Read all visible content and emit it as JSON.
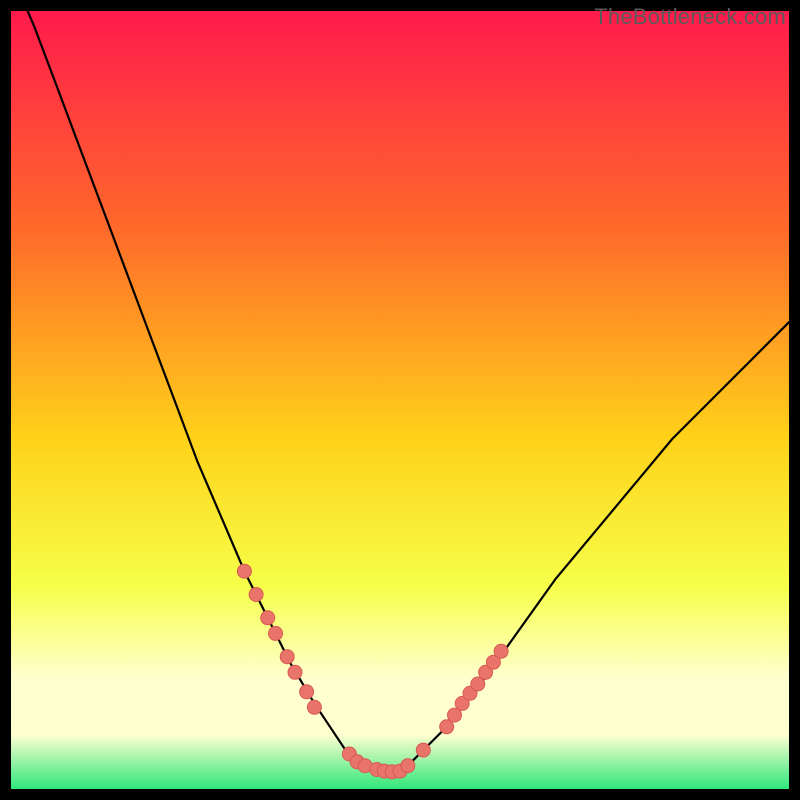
{
  "watermark": "TheBottleneck.com",
  "colors": {
    "frame_bg": "#000000",
    "gradient_top": "#ff1a4c",
    "gradient_mid1": "#ff6a2a",
    "gradient_mid2": "#ffd21a",
    "gradient_mid3": "#f6ff4a",
    "gradient_bottom_band": "#ffffd0",
    "gradient_bottom": "#2fe77a",
    "curve": "#000000",
    "points_fill": "#e9756a",
    "points_stroke": "#d85a52"
  },
  "chart_data": {
    "type": "line",
    "title": "",
    "xlabel": "",
    "ylabel": "",
    "xlim": [
      0,
      100
    ],
    "ylim": [
      0,
      100
    ],
    "grid": false,
    "legend": "none",
    "series": [
      {
        "name": "curve",
        "x": [
          0,
          3,
          6,
          9,
          12,
          15,
          18,
          21,
          24,
          27,
          30,
          33,
          36,
          39,
          41,
          43,
          45,
          47,
          49,
          51,
          53,
          56,
          60,
          65,
          70,
          75,
          80,
          85,
          90,
          95,
          100
        ],
        "y": [
          105,
          98,
          90,
          82,
          74,
          66,
          58,
          50,
          42,
          35,
          28,
          22,
          16,
          11,
          8,
          5,
          3,
          2,
          2,
          3,
          5,
          8,
          13,
          20,
          27,
          33,
          39,
          45,
          50,
          55,
          60
        ]
      }
    ],
    "points": [
      {
        "x": 30.0,
        "y": 28.0
      },
      {
        "x": 31.5,
        "y": 25.0
      },
      {
        "x": 33.0,
        "y": 22.0
      },
      {
        "x": 34.0,
        "y": 20.0
      },
      {
        "x": 35.5,
        "y": 17.0
      },
      {
        "x": 36.5,
        "y": 15.0
      },
      {
        "x": 38.0,
        "y": 12.5
      },
      {
        "x": 39.0,
        "y": 10.5
      },
      {
        "x": 43.5,
        "y": 4.5
      },
      {
        "x": 44.5,
        "y": 3.5
      },
      {
        "x": 45.5,
        "y": 3.0
      },
      {
        "x": 47.0,
        "y": 2.5
      },
      {
        "x": 48.0,
        "y": 2.3
      },
      {
        "x": 49.0,
        "y": 2.2
      },
      {
        "x": 50.0,
        "y": 2.3
      },
      {
        "x": 51.0,
        "y": 3.0
      },
      {
        "x": 53.0,
        "y": 5.0
      },
      {
        "x": 56.0,
        "y": 8.0
      },
      {
        "x": 57.0,
        "y": 9.5
      },
      {
        "x": 58.0,
        "y": 11.0
      },
      {
        "x": 59.0,
        "y": 12.3
      },
      {
        "x": 60.0,
        "y": 13.5
      },
      {
        "x": 61.0,
        "y": 15.0
      },
      {
        "x": 62.0,
        "y": 16.3
      },
      {
        "x": 63.0,
        "y": 17.7
      }
    ]
  }
}
